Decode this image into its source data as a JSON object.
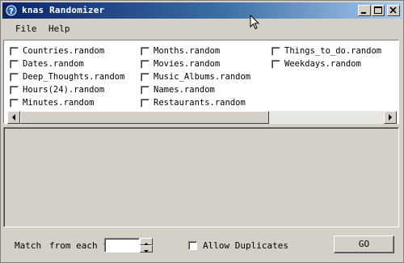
{
  "window": {
    "title": "knas Randomizer"
  },
  "menu": [
    "File",
    "Help"
  ],
  "lists": {
    "col1": [
      "Countries.random",
      "Dates.random",
      "Deep_Thoughts.random",
      "Hours(24).random",
      "Minutes.random"
    ],
    "col2": [
      "Months.random",
      "Movies.random",
      "Music_Albums.random",
      "Names.random",
      "Restaurants.random"
    ],
    "col3": [
      "Things_to_do.random",
      "Weekdays.random"
    ]
  },
  "bottom": {
    "match_label": "Match",
    "from_each_file_label": "from each file",
    "match_value": "",
    "allow_duplicates_label": "Allow Duplicates",
    "go_label": "GO"
  },
  "colors": {
    "titlebar_start": "#0a246a",
    "titlebar_end": "#a6caf0",
    "face": "#d4d0c8"
  }
}
